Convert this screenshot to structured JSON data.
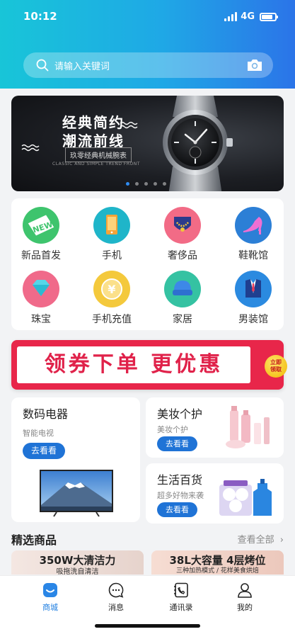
{
  "status": {
    "time": "10:12",
    "network": "4G"
  },
  "search": {
    "placeholder": "请输入关键词"
  },
  "banner": {
    "line1": "经典简约",
    "line2": "潮流前线",
    "subtitle": "玖零经典机械腕表",
    "english": "CLASSIC AND SIMPLE TREND FRONT",
    "slide_count": 5,
    "active_slide": 1
  },
  "categories": [
    {
      "label": "新品首发",
      "icon": "new-badge-icon",
      "color": "#3ec46d"
    },
    {
      "label": "手机",
      "icon": "phone-icon",
      "color": "#1fb5c9"
    },
    {
      "label": "奢侈品",
      "icon": "necklace-icon",
      "color": "#f26b86"
    },
    {
      "label": "鞋靴馆",
      "icon": "high-heel-icon",
      "color": "#2c7fd6"
    },
    {
      "label": "珠宝",
      "icon": "diamond-icon",
      "color": "#f06a8a"
    },
    {
      "label": "手机充值",
      "icon": "coin-yen-icon",
      "color": "#f4c93c"
    },
    {
      "label": "家居",
      "icon": "sofa-icon",
      "color": "#35c2a2"
    },
    {
      "label": "男装馆",
      "icon": "suit-icon",
      "color": "#2b8ae0"
    }
  ],
  "coupon": {
    "text": "领券下单 更优惠",
    "badge_line1": "立即",
    "badge_line2": "领取"
  },
  "cards": {
    "digital": {
      "title": "数码电器",
      "desc": "智能电视",
      "button": "去看看"
    },
    "beauty": {
      "title": "美妆个护",
      "desc": "美妆个护",
      "button": "去看看"
    },
    "living": {
      "title": "生活百货",
      "desc": "超多好物来袭",
      "button": "去看看"
    }
  },
  "featured": {
    "title": "精选商品",
    "more": "查看全部",
    "promo_left": {
      "headline": "350W大清洁力",
      "sub": "吸拖洗自清洁"
    },
    "promo_right": {
      "headline": "38L大容量 4层烤位",
      "sub": "三种加热模式 / 花样美食烘焙"
    }
  },
  "tabbar": [
    {
      "label": "商城",
      "icon": "shop-icon",
      "active": true
    },
    {
      "label": "消息",
      "icon": "message-icon",
      "active": false
    },
    {
      "label": "通讯录",
      "icon": "contacts-icon",
      "active": false
    },
    {
      "label": "我的",
      "icon": "profile-icon",
      "active": false
    }
  ],
  "colors": {
    "primary": "#1f73d6",
    "accent_red": "#e8264a",
    "header_start": "#18c5d8",
    "header_end": "#2b74e8"
  }
}
